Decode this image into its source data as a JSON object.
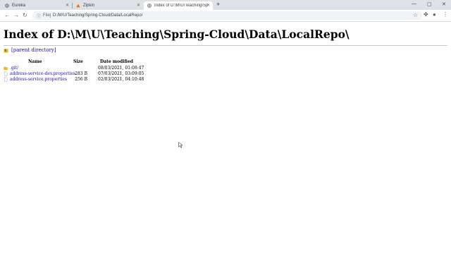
{
  "browser": {
    "tabs": [
      {
        "title": "Eureka",
        "icon": "globe-icon"
      },
      {
        "title": "Zipkin",
        "icon": "zipkin-triangle-icon"
      },
      {
        "title": "Index of D:\\M\\U\\Teaching\\Spring-...",
        "icon": "globe-icon"
      }
    ],
    "new_tab": "+",
    "address": {
      "scheme": "File",
      "url": "D:/M/U/Teaching/Spring-Cloud/Data/LocalRepo/"
    }
  },
  "page": {
    "title": "Index of D:\\M\\U\\Teaching\\Spring-Cloud\\Data\\LocalRepo\\",
    "parent_link": "[parent directory]",
    "columns": {
      "name": "Name",
      "size": "Size",
      "date": "Date modified"
    },
    "entries": [
      {
        "name": ".git/",
        "size": "",
        "date": "08/03/2021, 01:08:47",
        "type": "folder"
      },
      {
        "name": "address-service-dev.properties",
        "size": "283 B",
        "date": "07/03/2021, 03:09:05",
        "type": "file"
      },
      {
        "name": "address-service.properties",
        "size": "256 B",
        "date": "02/03/2021, 04:10:48",
        "type": "file"
      }
    ]
  },
  "colors": {
    "link": "#1a0dab",
    "folder": "#e8b923",
    "tabbar": "#dee1e6"
  }
}
